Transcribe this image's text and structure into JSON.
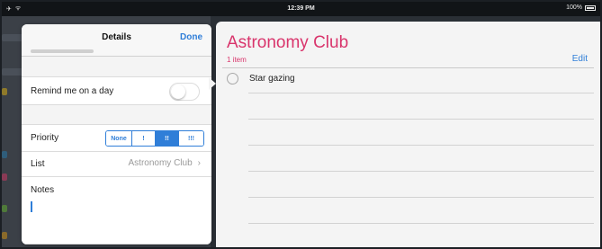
{
  "statusbar": {
    "time": "12:39 PM",
    "battery": "100%",
    "airplane_icon": "airplane-icon",
    "wifi_icon": "wifi-icon"
  },
  "popover": {
    "title": "Details",
    "done_label": "Done",
    "remind_label": "Remind me on a day",
    "remind_on": false,
    "priority_label": "Priority",
    "priority_options": [
      "None",
      "!",
      "!!",
      "!!!"
    ],
    "priority_selected": "!!",
    "list_label": "List",
    "list_value": "Astronomy Club",
    "notes_label": "Notes",
    "notes_value": ""
  },
  "list": {
    "title": "Astronomy Club",
    "count": "1 item",
    "edit_label": "Edit",
    "items": [
      {
        "text": "Star gazing",
        "completed": false
      }
    ]
  },
  "colors": {
    "accent": "#2f7ed8",
    "list_color": "#d9356c"
  }
}
